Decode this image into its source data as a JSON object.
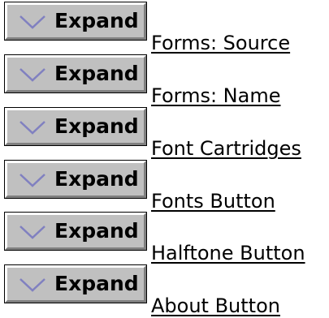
{
  "rows": [
    {
      "button_label": "Expand",
      "link_text": "Forms: Source"
    },
    {
      "button_label": "Expand",
      "link_text": "Forms: Name"
    },
    {
      "button_label": "Expand",
      "link_text": "Font Cartridges"
    },
    {
      "button_label": "Expand",
      "link_text": "Fonts Button"
    },
    {
      "button_label": "Expand",
      "link_text": "Halftone Button"
    },
    {
      "button_label": "Expand",
      "link_text": "About Button"
    }
  ],
  "icons": {
    "expand": "chevron-down-icon"
  },
  "colors": {
    "button_face": "#c0c0c0",
    "chevron": "#8080c0",
    "text": "#000000"
  }
}
